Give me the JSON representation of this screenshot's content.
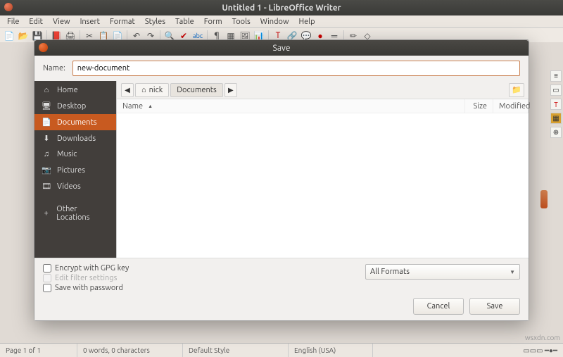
{
  "window": {
    "title": "Untitled 1 - LibreOffice Writer"
  },
  "menu": {
    "items": [
      "File",
      "Edit",
      "View",
      "Insert",
      "Format",
      "Styles",
      "Table",
      "Form",
      "Tools",
      "Window",
      "Help"
    ]
  },
  "styleCombo": "Default S",
  "dialog": {
    "title": "Save",
    "nameLabel": "Name:",
    "nameValue": "new-document",
    "places": [
      {
        "icon": "⌂",
        "label": "Home"
      },
      {
        "icon": "🖥",
        "label": "Desktop"
      },
      {
        "icon": "📄",
        "label": "Documents",
        "active": true
      },
      {
        "icon": "⬇",
        "label": "Downloads"
      },
      {
        "icon": "♫",
        "label": "Music"
      },
      {
        "icon": "📷",
        "label": "Pictures"
      },
      {
        "icon": "🎞",
        "label": "Videos"
      },
      {
        "icon": "+",
        "label": "Other Locations",
        "sep": true
      }
    ],
    "path": {
      "back": "◀",
      "home": "⌂",
      "user": "nick",
      "current": "Documents",
      "fwd": "▶"
    },
    "columns": {
      "name": "Name",
      "size": "Size",
      "modified": "Modified"
    },
    "checks": {
      "gpg": "Encrypt with GPG key",
      "filter": "Edit filter settings",
      "pwd": "Save with password"
    },
    "format": "All Formats",
    "buttons": {
      "cancel": "Cancel",
      "save": "Save"
    }
  },
  "status": {
    "page": "Page 1 of 1",
    "words": "0 words, 0 characters",
    "style": "Default Style",
    "lang": "English (USA)"
  },
  "watermark": "wsxdn.com"
}
